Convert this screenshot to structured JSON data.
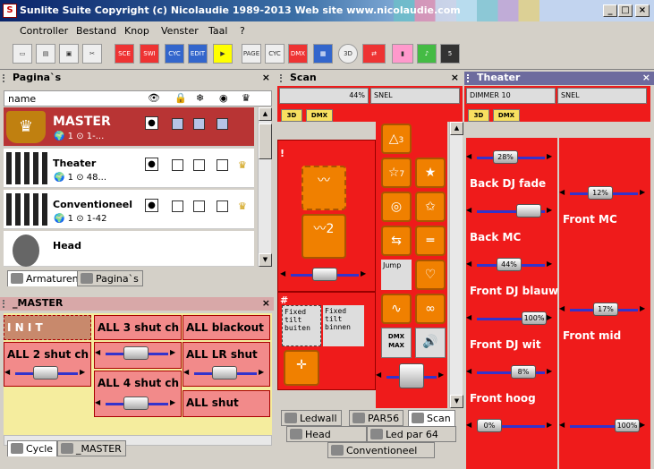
{
  "window": {
    "title": "Sunlite Suite    Copyright (c) Nicolaudie 1989-2013    Web site www.nicolaudie.com",
    "app_icon": "S"
  },
  "menu": [
    "Controller",
    "Bestand",
    "Knop",
    "Venster",
    "Taal",
    "?"
  ],
  "toolbar": [
    "new",
    "open",
    "save",
    "cut",
    "SCE",
    "SWI",
    "CYC",
    "EDIT",
    "flag",
    "PAGE",
    "CYC",
    "DMX",
    "grid",
    "3D",
    "swap",
    "bars",
    "music",
    "5"
  ],
  "pages_panel": {
    "title": "Pagina`s",
    "name_header": "name",
    "items": [
      {
        "name": "MASTER",
        "count": "1",
        "dmx": "1-...",
        "highlighted": true
      },
      {
        "name": "Theater",
        "count": "1",
        "dmx": "48..."
      },
      {
        "name": "Conventioneel",
        "count": "1",
        "dmx": "1-42"
      },
      {
        "name": "Head",
        "count": "",
        "dmx": ""
      }
    ],
    "tabs": [
      "Armaturen",
      "Pagina`s"
    ]
  },
  "master_panel": {
    "title": "_MASTER",
    "buttons": [
      "I N I T",
      "ALL 3 shut ch",
      "ALL blackout",
      "ALL 2 shut ch",
      "ALL LR shut",
      "ALL 4 shut ch",
      "ALL shut"
    ],
    "tabs": [
      "Cycle",
      "_MASTER"
    ]
  },
  "scan_panel": {
    "title": "Scan",
    "top_sliders": [
      "44%",
      "SNEL"
    ],
    "labels": {
      "dmx": "DMX",
      "three_d": "3D"
    },
    "fixed_buiten": "Fixed tilt buiten",
    "fixed_binnen": "Fixed tilt binnen",
    "scan_num_1": "2",
    "scan_num_2": "3",
    "scan_num_3": "7",
    "jump": "Jump",
    "dmx_max": "DMX MAX",
    "bottom_tabs": [
      "Ledwall",
      "PAR56",
      "Scan",
      "Head",
      "Led par 64",
      "Conventioneel"
    ],
    "exclaim": "!",
    "hash": "#"
  },
  "theater_panel": {
    "title": "Theater",
    "top_sliders": [
      "DIMMER 10",
      "SNEL"
    ],
    "labels": [
      "Back DJ fade",
      "Back MC",
      "Front DJ blauw",
      "Front DJ wit",
      "Front hoog"
    ],
    "right_labels": [
      "Front MC",
      "Front mid"
    ],
    "slider_values": [
      "28%",
      "44%",
      "100%",
      "8%",
      "0%"
    ],
    "right_values": [
      "12%",
      "17%",
      "100%"
    ]
  },
  "colors": {
    "red": "#ef1b1b",
    "pink": "#f28a8a",
    "highlight": "#b83434"
  }
}
